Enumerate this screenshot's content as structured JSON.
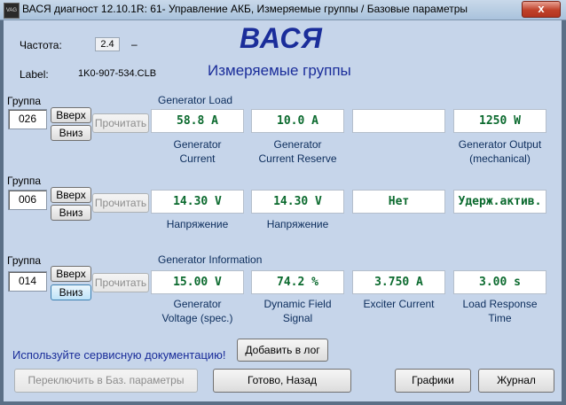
{
  "window": {
    "title": "ВАСЯ диагност 12.10.1R: 61- Управление АКБ,  Измеряемые группы / Базовые параметры",
    "icon_text": "VAG",
    "close_label": "x"
  },
  "header": {
    "freq_label": "Частота:",
    "freq_value": "2.4",
    "freq_dash": "–",
    "label_caption": "Label:",
    "label_value": "1K0-907-534.CLB",
    "brand": "ВАСЯ",
    "subtitle": "Измеряемые группы"
  },
  "groups": [
    {
      "label": "Группа",
      "number": "026",
      "up": "Вверх",
      "down": "Вниз",
      "read": "Прочитать",
      "title": "Generator Load",
      "fields": [
        {
          "value": "58.8 A",
          "caption": "Generator\nCurrent"
        },
        {
          "value": "10.0 A",
          "caption": "Generator\nCurrent Reserve"
        },
        {
          "value": "",
          "caption": ""
        },
        {
          "value": "1250 W",
          "caption": "Generator Output\n(mechanical)"
        }
      ]
    },
    {
      "label": "Группа",
      "number": "006",
      "up": "Вверх",
      "down": "Вниз",
      "read": "Прочитать",
      "title": "",
      "fields": [
        {
          "value": "14.30 V",
          "caption": "Напряжение"
        },
        {
          "value": "14.30 V",
          "caption": "Напряжение"
        },
        {
          "value": "Нет",
          "caption": ""
        },
        {
          "value": "Удерж.актив.",
          "caption": ""
        }
      ]
    },
    {
      "label": "Группа",
      "number": "014",
      "up": "Вверх",
      "down": "Вниз",
      "read": "Прочитать",
      "title": "Generator Information",
      "fields": [
        {
          "value": "15.00 V",
          "caption": "Generator\nVoltage (spec.)"
        },
        {
          "value": "74.2 %",
          "caption": "Dynamic Field\nSignal"
        },
        {
          "value": "3.750 A",
          "caption": "Exciter Current"
        },
        {
          "value": "3.00 s",
          "caption": "Load Response\nTime"
        }
      ]
    }
  ],
  "footer": {
    "note": "Используйте сервисную документацию!",
    "add_log": "Добавить в лог",
    "switch_basic": "Переключить в Баз. параметры",
    "done_back": "Готово, Назад",
    "graphs": "Графики",
    "journal": "Журнал"
  },
  "colors": {
    "value_text": "#0b6a2e",
    "caption_text": "#0c2d5c",
    "brand": "#1a2d9a",
    "background": "#c6d5ea"
  }
}
